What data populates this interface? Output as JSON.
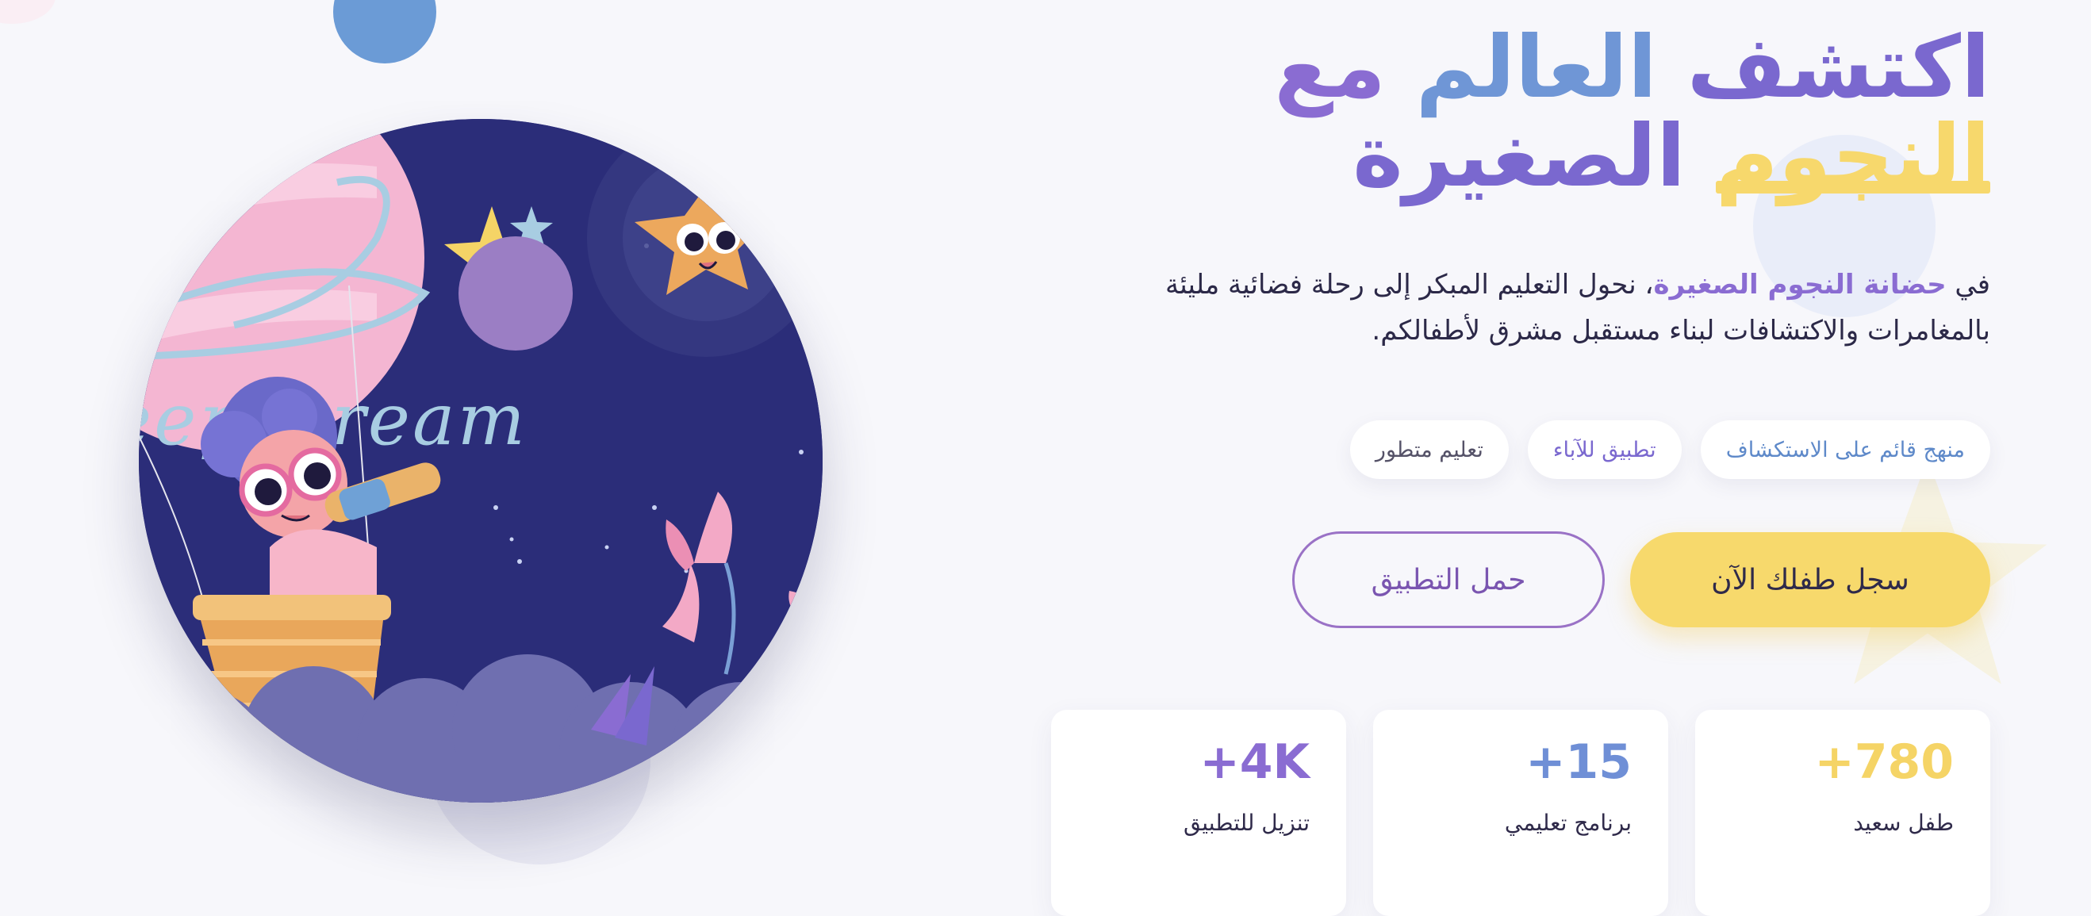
{
  "hero": {
    "title_part1": "اكتشف ",
    "title_part2": "العالم",
    "title_part3": " مع",
    "title_accent": "النجوم",
    "title_part4": " الصغيرة",
    "intro_prefix": "في ",
    "intro_brand": "حضانة النجوم الصغيرة",
    "intro_rest": "، نحول التعليم المبكر إلى رحلة فضائية مليئة بالمغامرات والاكتشافات لبناء مستقبل مشرق لأطفالكم.",
    "illustration_text": "Keep Dream"
  },
  "features": [
    {
      "label": "منهج قائم على الاستكشاف",
      "color": "#5e89c9"
    },
    {
      "label": "تطبيق للآباء",
      "color": "#7a68cf"
    },
    {
      "label": "تعليم متطور",
      "color": "#555268"
    }
  ],
  "cta": {
    "primary_label": "سجل طفلك الآن",
    "secondary_label": "حمل التطبيق"
  },
  "stats": [
    {
      "value": "+780",
      "label": "طفل سعيد",
      "color": "#f5d466"
    },
    {
      "value": "+15",
      "label": "برنامج تعليمي",
      "color": "#6f8fd6"
    },
    {
      "value": "+4K",
      "label": "تنزيل للتطبيق",
      "color": "#8a6cd2"
    }
  ],
  "colors": {
    "background": "#f7f7fb",
    "brand_purple": "#7a68cf",
    "brand_blue": "#6f96d6",
    "accent_yellow": "#f7d86c",
    "night_sky": "#2b2d79"
  },
  "icons": [
    "illustration-moon-icon",
    "illustration-star-icon",
    "illustration-planet-icon",
    "background-star-icon"
  ]
}
